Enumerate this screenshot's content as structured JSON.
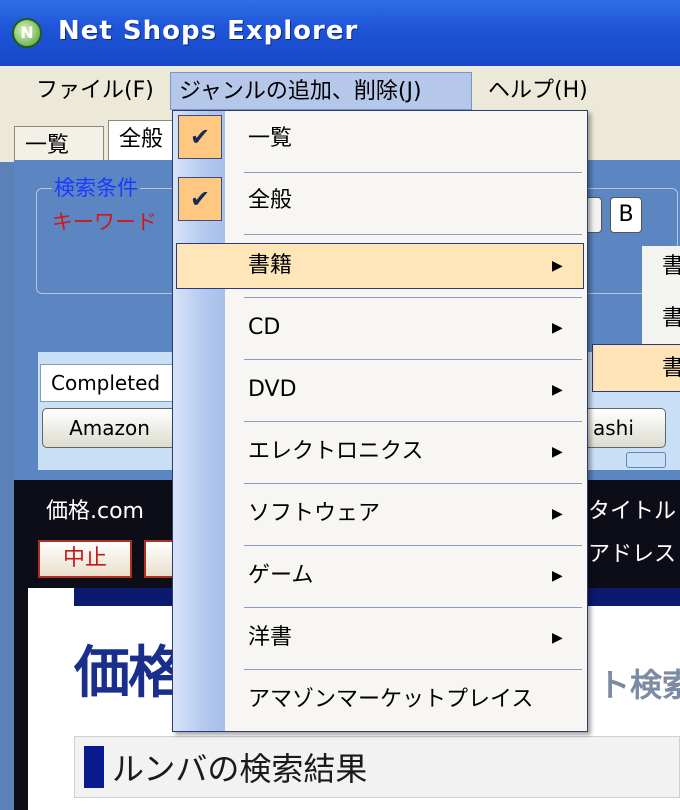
{
  "window": {
    "title": "Net Shops Explorer",
    "icon": "app-logo-icon",
    "icon_letter": "N"
  },
  "menubar": {
    "file": "ファイル(F)",
    "genre": "ジャンルの追加、削除(J)",
    "help": "ヘルプ(H)"
  },
  "tabs": [
    {
      "label": "一覧"
    },
    {
      "label": "全般"
    }
  ],
  "search": {
    "legend": "検索条件",
    "keyword_label": "キーワード",
    "b_button": "B",
    "completed_value": "Completed",
    "amazon_button": "Amazon",
    "ashi_button": "ashi"
  },
  "results": {
    "kakaku_label": "価格.com",
    "stop_button": "中止",
    "title_label": "タイトル",
    "address_label": "アドレス",
    "logo_text": "価格",
    "search_hint": "ト検索",
    "result_heading": "ルンバの検索結果"
  },
  "dropdown": {
    "items": [
      {
        "label": "一覧",
        "checked": true,
        "has_submenu": false
      },
      {
        "label": "全般",
        "checked": true,
        "has_submenu": false
      },
      {
        "label": "書籍",
        "checked": false,
        "has_submenu": true,
        "highlighted": true
      },
      {
        "label": "CD",
        "checked": false,
        "has_submenu": true
      },
      {
        "label": "DVD",
        "checked": false,
        "has_submenu": true
      },
      {
        "label": "エレクトロニクス",
        "checked": false,
        "has_submenu": true
      },
      {
        "label": "ソフトウェア",
        "checked": false,
        "has_submenu": true
      },
      {
        "label": "ゲーム",
        "checked": false,
        "has_submenu": true
      },
      {
        "label": "洋書",
        "checked": false,
        "has_submenu": true
      },
      {
        "label": "アマゾンマーケットプレイス",
        "checked": false,
        "has_submenu": false
      }
    ],
    "check_glyph": "✔",
    "arrow_glyph": "▶"
  },
  "submenu": {
    "items": [
      {
        "label": "書"
      },
      {
        "label": "書"
      },
      {
        "label": "書"
      }
    ]
  },
  "colors": {
    "title_bar": "#1f55d8",
    "highlight": "#ffe6b8",
    "check_bg": "#ffc880"
  }
}
